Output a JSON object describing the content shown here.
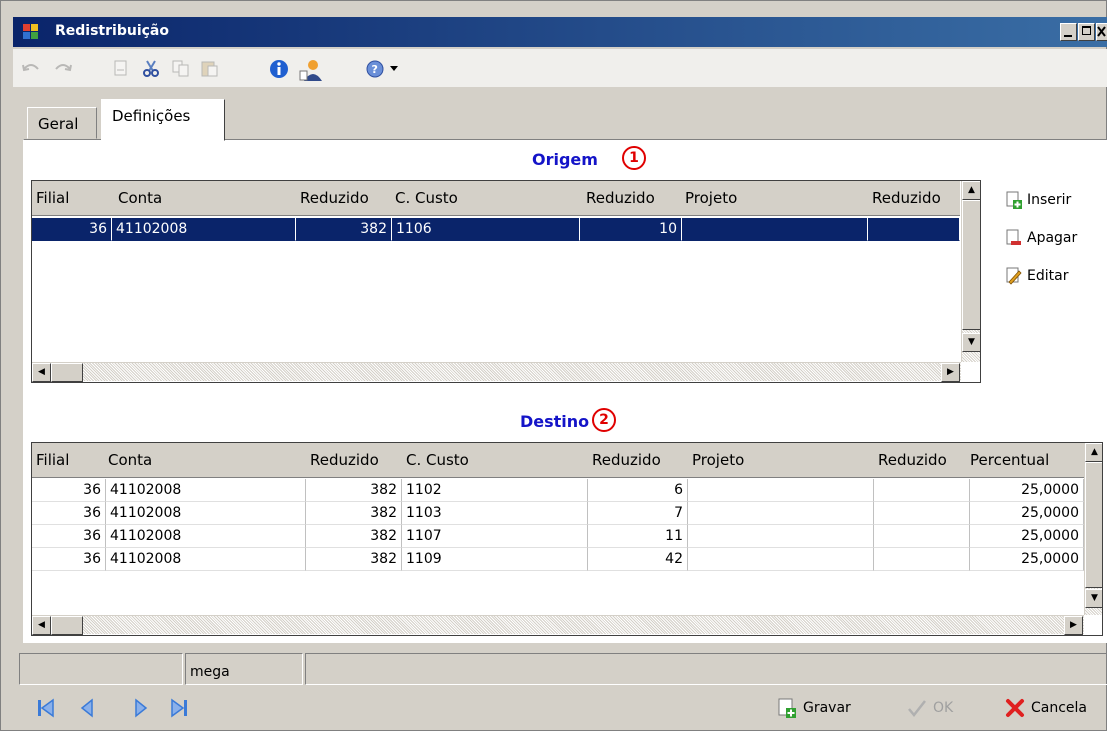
{
  "window": {
    "title": "Redistribuição"
  },
  "toolbar": {
    "buttons": [
      "undo-icon",
      "redo-icon",
      "new-document-icon",
      "cut-icon",
      "copy-icon",
      "paste-icon",
      "info-icon",
      "user-icon",
      "help-icon",
      "dropdown-arrow-icon"
    ]
  },
  "tabs": [
    {
      "label": "Geral",
      "active": false
    },
    {
      "label": "Definições",
      "active": true
    }
  ],
  "origem": {
    "title": "Origem",
    "marker": "1",
    "columns": [
      "Filial",
      "Conta",
      "Reduzido",
      "C. Custo",
      "Reduzido",
      "Projeto",
      "Reduzido"
    ],
    "rows": [
      {
        "filial": "36",
        "conta": "41102008",
        "reduzido": "382",
        "ccusto": "1106",
        "reduzido2": "10",
        "projeto": "",
        "reduzido3": ""
      }
    ]
  },
  "side_actions": {
    "inserir": "Inserir",
    "apagar": "Apagar",
    "editar": "Editar"
  },
  "destino": {
    "title": "Destino",
    "marker": "2",
    "columns": [
      "Filial",
      "Conta",
      "Reduzido",
      "C. Custo",
      "Reduzido",
      "Projeto",
      "Reduzido",
      "Percentual"
    ],
    "rows": [
      {
        "filial": "36",
        "conta": "41102008",
        "reduzido": "382",
        "ccusto": "1102",
        "reduzido2": "6",
        "projeto": "",
        "reduzido3": "",
        "percentual": "25,0000"
      },
      {
        "filial": "36",
        "conta": "41102008",
        "reduzido": "382",
        "ccusto": "1103",
        "reduzido2": "7",
        "projeto": "",
        "reduzido3": "",
        "percentual": "25,0000"
      },
      {
        "filial": "36",
        "conta": "41102008",
        "reduzido": "382",
        "ccusto": "1107",
        "reduzido2": "11",
        "projeto": "",
        "reduzido3": "",
        "percentual": "25,0000"
      },
      {
        "filial": "36",
        "conta": "41102008",
        "reduzido": "382",
        "ccusto": "1109",
        "reduzido2": "42",
        "projeto": "",
        "reduzido3": "",
        "percentual": "25,0000"
      }
    ]
  },
  "status": {
    "panel1": "",
    "user": "mega",
    "panel3": ""
  },
  "footer": {
    "gravar": "Gravar",
    "ok": "OK",
    "cancela": "Cancela"
  },
  "colors": {
    "title_bar": "#0a246a",
    "selection": "#0a246a",
    "section_title": "#1414c8",
    "marker": "#e00000"
  }
}
